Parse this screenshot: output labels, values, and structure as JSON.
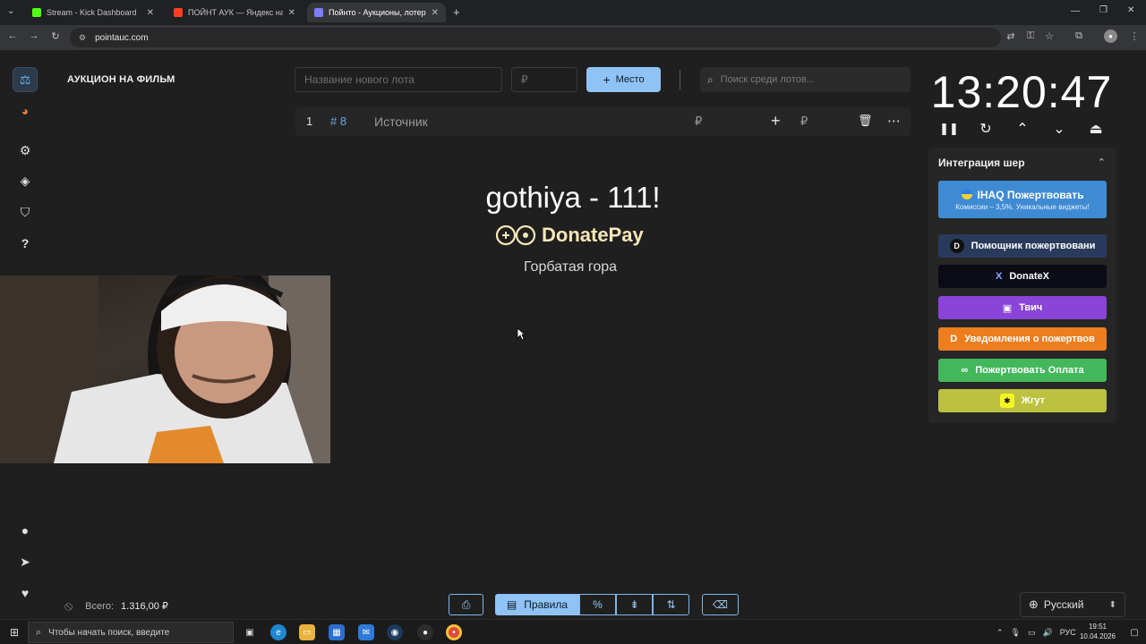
{
  "browser": {
    "tabs": [
      {
        "title": "Stream - Kick Dashboard",
        "favicon_color": "#53fc18",
        "active": false
      },
      {
        "title": "ПОЙНТ АУК — Яндекс нашло",
        "favicon_color": "#fc3f1d",
        "active": false
      },
      {
        "title": "Пойнто - Аукционы, лотереи",
        "favicon_color": "#7d7dff",
        "active": true
      }
    ],
    "new_tab_label": "+",
    "url": "pointauc.com",
    "window_controls": {
      "minimize": "—",
      "restore": "❐",
      "close": "✕"
    }
  },
  "sidebar": {
    "top_icons": [
      {
        "name": "auction-icon",
        "glyph": "⚖",
        "active": true
      },
      {
        "name": "wheel-icon",
        "glyph": "◕",
        "active": false
      },
      {
        "name": "settings-icon",
        "glyph": "⚙",
        "active": false
      },
      {
        "name": "layers-icon",
        "glyph": "◈",
        "active": false
      },
      {
        "name": "shield-icon",
        "glyph": "⛉",
        "active": false
      },
      {
        "name": "help-icon",
        "glyph": "?",
        "active": false
      }
    ],
    "bottom_icons": [
      {
        "name": "github-icon",
        "glyph": "●"
      },
      {
        "name": "telegram-icon",
        "glyph": "➤"
      },
      {
        "name": "donate-hand-icon",
        "glyph": "♥"
      }
    ]
  },
  "header": {
    "auction_title": "АУКЦИОН НА ФИЛЬМ",
    "new_lot_placeholder": "Название нового лота",
    "amount_placeholder": "₽",
    "place_button": "Место",
    "place_button_icon": "+",
    "search_placeholder": "Поиск среди лотов..."
  },
  "lot": {
    "index": "1",
    "id": "# 8",
    "name": "Источник",
    "currency": "₽",
    "add_icon": "+",
    "add_currency": "₽",
    "delete_icon": "🗑",
    "more_icon": "⋯"
  },
  "winner": {
    "message": "gothiya - 111!",
    "source": "DonatePay",
    "movie": "Горбатая гора"
  },
  "timer": {
    "value": "13:20:47",
    "controls": [
      "❚❚",
      "↻",
      "⌃",
      "⌄",
      "⏏"
    ]
  },
  "integrations": {
    "title": "Интеграция шер",
    "toggle": "⌃",
    "iq": {
      "label": "IHAQ Пожертвовать",
      "sub": "Комиссии – 3,5%. Уникальные виджеты!",
      "color": "#3f8bd3"
    },
    "items": [
      {
        "name": "donation-alerts",
        "label": "Помощник пожертвовани",
        "icon": "D",
        "color": "#2a3a5c"
      },
      {
        "name": "donatex",
        "label": "DonateX",
        "icon": "X",
        "color": "#0b0b16"
      },
      {
        "name": "twitch",
        "label": "Твич",
        "icon": "▣",
        "color": "#8a44d8"
      },
      {
        "name": "donation-alerts-orange",
        "label": "Уведомления о пожертвов",
        "icon": "D",
        "color": "#ed7d1f"
      },
      {
        "name": "donatepay",
        "label": "Пожертвовать Оплата",
        "icon": "∞",
        "color": "#43b85a"
      },
      {
        "name": "zhgut",
        "label": "Жгут",
        "icon": "✱",
        "color": "#bcc240"
      }
    ]
  },
  "footer": {
    "total_label": "Всего:",
    "total_value": "1.316,00 ₽",
    "hidden_icon": "⦸",
    "controls": [
      {
        "name": "save-button",
        "glyph": "⎙"
      },
      {
        "name": "rules-button",
        "glyph": "▤",
        "label": "Правила"
      },
      {
        "name": "percent-button",
        "glyph": "%"
      },
      {
        "name": "split-button",
        "glyph": "⇟"
      },
      {
        "name": "sort-button",
        "glyph": "⇅"
      },
      {
        "name": "clear-button",
        "glyph": "⌫"
      }
    ],
    "language": "Русский",
    "language_icon": "⊕",
    "language_chevron": "⬍"
  },
  "taskbar": {
    "search_placeholder": "Чтобы начать поиск, введите",
    "tray_lang": "РУС",
    "time": "19:51",
    "date": "10.04.2026"
  }
}
